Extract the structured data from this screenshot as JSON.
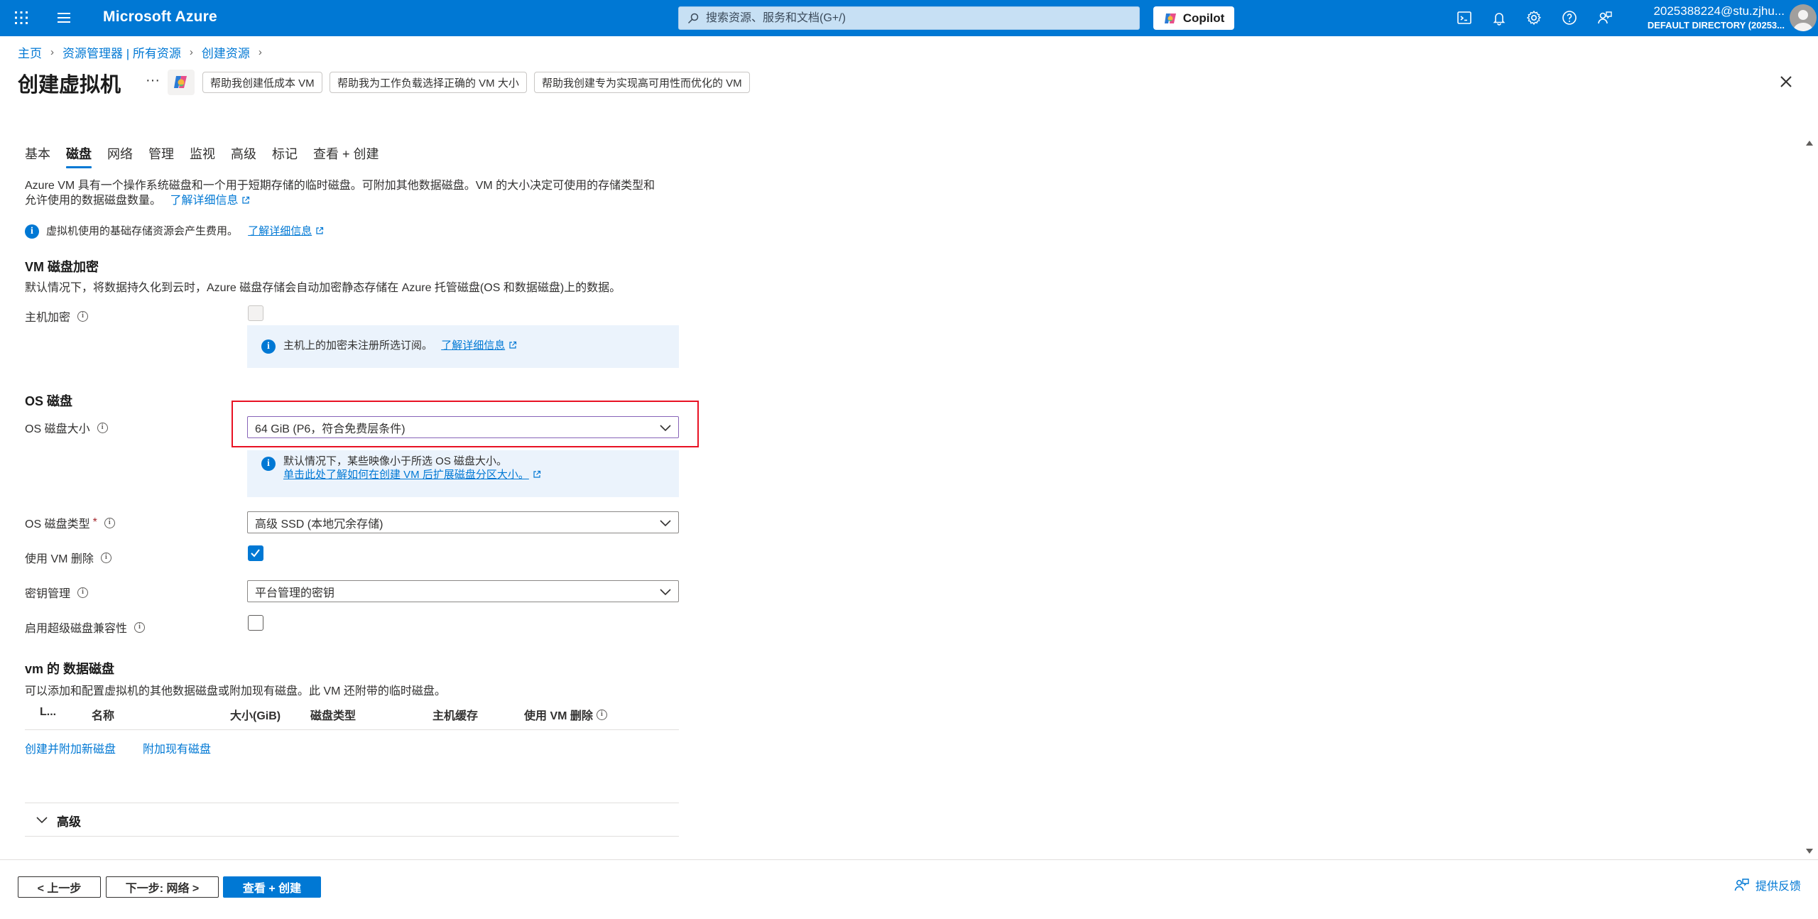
{
  "topbar": {
    "brand": "Microsoft Azure",
    "search_placeholder": "搜索资源、服务和文档(G+/)",
    "copilot_label": "Copilot",
    "account_user": "2025388224@stu.zjhu...",
    "account_directory": "DEFAULT DIRECTORY (20253..."
  },
  "breadcrumb": [
    "主页",
    "资源管理器 | 所有资源",
    "创建资源"
  ],
  "page": {
    "title": "创建虚拟机",
    "more": "···",
    "suggestions": [
      "帮助我创建低成本 VM",
      "帮助我为工作负载选择正确的 VM 大小",
      "帮助我创建专为实现高可用性而优化的 VM"
    ]
  },
  "tabs": [
    {
      "label": "基本",
      "active": false
    },
    {
      "label": "磁盘",
      "active": true
    },
    {
      "label": "网络",
      "active": false
    },
    {
      "label": "管理",
      "active": false
    },
    {
      "label": "监视",
      "active": false
    },
    {
      "label": "高级",
      "active": false
    },
    {
      "label": "标记",
      "active": false
    },
    {
      "label": "查看 + 创建",
      "active": false
    }
  ],
  "intro": {
    "line1": "Azure VM 具有一个操作系统磁盘和一个用于短期存储的临时磁盘。可附加其他数据磁盘。VM 的大小决定可使用的存储类型和",
    "line2": "允许使用的数据磁盘数量。",
    "link": "了解详细信息"
  },
  "cost_info": {
    "text": "虚拟机使用的基础存储资源会产生费用。",
    "link": "了解详细信息"
  },
  "encryption": {
    "heading": "VM 磁盘加密",
    "description": "默认情况下，将数据持久化到云时，Azure 磁盘存储会自动加密静态存储在 Azure 托管磁盘(OS 和数据磁盘)上的数据。",
    "host_label": "主机加密",
    "host_checked": false,
    "host_info_text": "主机上的加密未注册所选订阅。",
    "host_info_link": "了解详细信息"
  },
  "os_disk": {
    "heading": "OS 磁盘",
    "size_label": "OS 磁盘大小",
    "size_value": "64 GiB (P6，符合免费层条件)",
    "size_info_text": "默认情况下，某些映像小于所选 OS 磁盘大小。",
    "size_info_link": "单击此处了解如何在创建 VM 后扩展磁盘分区大小。",
    "type_label": "OS 磁盘类型",
    "type_required": "*",
    "type_value": "高级 SSD (本地冗余存储)",
    "delete_label": "使用 VM 删除",
    "delete_checked": true,
    "key_label": "密钥管理",
    "key_value": "平台管理的密钥",
    "ultra_label": "启用超级磁盘兼容性",
    "ultra_checked": false
  },
  "data_disks": {
    "heading": "vm 的 数据磁盘",
    "description": "可以添加和配置虚拟机的其他数据磁盘或附加现有磁盘。此 VM 还附带的临时磁盘。",
    "columns": [
      "L...",
      "名称",
      "大小(GiB)",
      "磁盘类型",
      "主机缓存",
      "使用 VM 删除"
    ],
    "create_link": "创建并附加新磁盘",
    "attach_link": "附加现有磁盘"
  },
  "advanced": {
    "label": "高级"
  },
  "footer": {
    "prev": "< 上一步",
    "next": "下一步: 网络 >",
    "review": "查看 + 创建",
    "feedback": "提供反馈"
  },
  "colors": {
    "accent": "#0078d4",
    "highlight_box": "#e81123"
  }
}
